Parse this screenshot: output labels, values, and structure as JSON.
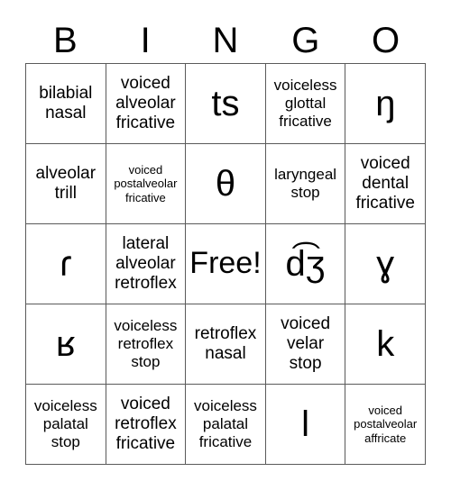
{
  "card": {
    "header_letters": [
      "B",
      "I",
      "N",
      "G",
      "O"
    ],
    "rows": [
      [
        {
          "text": "bilabial\nnasal",
          "style": "word"
        },
        {
          "text": "voiced\nalveolar\nfricative",
          "style": "word"
        },
        {
          "text": "ts",
          "style": "symbol"
        },
        {
          "text": "voiceless\nglottal\nfricative",
          "style": "word-md"
        },
        {
          "text": "ŋ",
          "style": "symbol"
        }
      ],
      [
        {
          "text": "alveolar\ntrill",
          "style": "word"
        },
        {
          "text": "voiced\npostalveolar\nfricative",
          "style": "word-sm"
        },
        {
          "text": "θ",
          "style": "symbol"
        },
        {
          "text": "laryngeal\nstop",
          "style": "word-md"
        },
        {
          "text": "voiced\ndental\nfricative",
          "style": "word"
        }
      ],
      [
        {
          "text": "ɾ",
          "style": "symbol"
        },
        {
          "text": "lateral\nalveolar\nretroflex",
          "style": "word"
        },
        {
          "text": "Free!",
          "style": "free"
        },
        {
          "text": "d͡ʒ",
          "style": "symbol"
        },
        {
          "text": "ɣ",
          "style": "symbol"
        }
      ],
      [
        {
          "text": "ʁ",
          "style": "symbol"
        },
        {
          "text": "voiceless\nretroflex\nstop",
          "style": "word-md"
        },
        {
          "text": "retroflex\nnasal",
          "style": "word"
        },
        {
          "text": "voiced\nvelar\nstop",
          "style": "word"
        },
        {
          "text": "k",
          "style": "symbol-sans"
        }
      ],
      [
        {
          "text": "voiceless\npalatal\nstop",
          "style": "word-md"
        },
        {
          "text": "voiced\nretroflex\nfricative",
          "style": "word"
        },
        {
          "text": "voiceless\npalatal\nfricative",
          "style": "word-md"
        },
        {
          "text": "l",
          "style": "symbol-sans"
        },
        {
          "text": "voiced\npostalveolar\naffricate",
          "style": "word-sm"
        }
      ]
    ]
  },
  "colors": {
    "border": "#5a5a5a",
    "text": "#000000",
    "background": "#ffffff"
  }
}
